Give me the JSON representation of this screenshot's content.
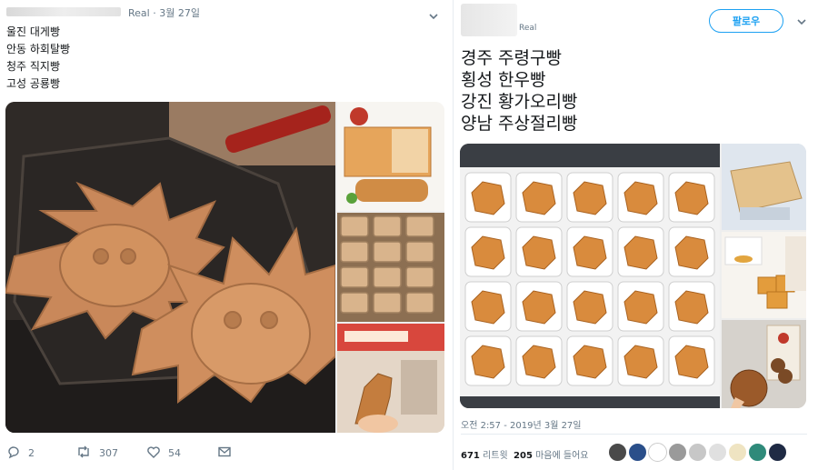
{
  "left_tweet": {
    "handle_time": "Real · 3월 27일",
    "lines": [
      "울진 대게빵",
      "안동 하회탈빵",
      "청주 직지빵",
      "고성 공룡빵"
    ],
    "actions": {
      "reply_count": "2",
      "retweet_count": "307",
      "like_count": "54"
    }
  },
  "right_tweet": {
    "handle": "Real",
    "follow_label": "팔로우",
    "lines": [
      "경주 주령구빵",
      "횡성 한우빵",
      "강진 황가오리빵",
      "양남 주상절리빵"
    ],
    "timestamp": "오전 2:57 - 2019년 3월 27일",
    "retweets_count": "671",
    "retweets_label": "리트윗",
    "likes_count": "205",
    "likes_label": "마음에 들어요"
  },
  "icons": [
    "more-chevron-icon",
    "reply-icon",
    "retweet-icon",
    "like-icon",
    "message-icon"
  ],
  "colors": {
    "accent": "#1da1f2",
    "muted_text": "#657786",
    "body_text": "#14171a",
    "divider": "#e6ecf0"
  }
}
